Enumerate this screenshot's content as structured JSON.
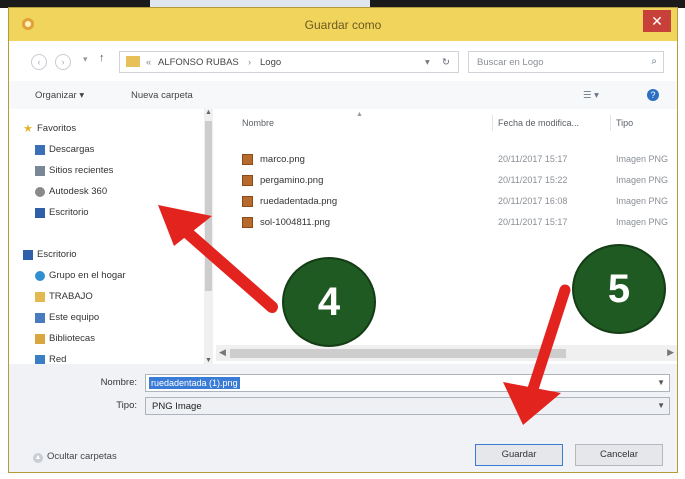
{
  "window": {
    "title": "Guardar como",
    "close_label": "✕"
  },
  "address": {
    "crumbs": [
      "ALFONSO RUBAS",
      "Logo"
    ],
    "separator": "›",
    "refresh_icon": "refresh-icon",
    "search_placeholder": "Buscar en Logo"
  },
  "toolbar": {
    "organize": "Organizar ▾",
    "new_folder": "Nueva carpeta"
  },
  "sidebar": {
    "items": [
      {
        "label": "Favoritos",
        "icon": "star-icon",
        "color": "#e5b531"
      },
      {
        "label": "Descargas",
        "icon": "download-icon",
        "color": "#3b6fb6"
      },
      {
        "label": "Sitios recientes",
        "icon": "recent-icon",
        "color": "#7a8796"
      },
      {
        "label": "Autodesk 360",
        "icon": "cloud-icon",
        "color": "#8a8a8a"
      },
      {
        "label": "Escritorio",
        "icon": "desktop-icon",
        "color": "#2e5fa8"
      },
      {
        "label": "Escritorio",
        "icon": "desktop-icon",
        "color": "#2e5fa8"
      },
      {
        "label": "Grupo en el hogar",
        "icon": "homegroup-icon",
        "color": "#2f8fd0"
      },
      {
        "label": "TRABAJO",
        "icon": "folder-icon",
        "color": "#e2b850"
      },
      {
        "label": "Este equipo",
        "icon": "computer-icon",
        "color": "#4a7bbf"
      },
      {
        "label": "Bibliotecas",
        "icon": "library-icon",
        "color": "#d9a640"
      },
      {
        "label": "Red",
        "icon": "network-icon",
        "color": "#3a7fc4"
      }
    ]
  },
  "files": {
    "columns": [
      "Nombre",
      "Fecha de modifica...",
      "Tipo"
    ],
    "rows": [
      {
        "name": "marco.png",
        "date": "20/11/2017 15:17",
        "type": "Imagen PNG"
      },
      {
        "name": "pergamino.png",
        "date": "20/11/2017 15:22",
        "type": "Imagen PNG"
      },
      {
        "name": "ruedadentada.png",
        "date": "20/11/2017 16:08",
        "type": "Imagen PNG"
      },
      {
        "name": "sol-1004811.png",
        "date": "20/11/2017 15:17",
        "type": "Imagen PNG"
      }
    ]
  },
  "form": {
    "name_label": "Nombre:",
    "name_value": "ruedadentada (1).png",
    "type_label": "Tipo:",
    "type_value": "PNG Image"
  },
  "footer": {
    "hide_folders": "Ocultar carpetas",
    "save": "Guardar",
    "cancel": "Cancelar"
  },
  "annotations": {
    "step4": "4",
    "step5": "5",
    "badge_color": "#1f5a22",
    "arrow_color": "#e3231e"
  }
}
